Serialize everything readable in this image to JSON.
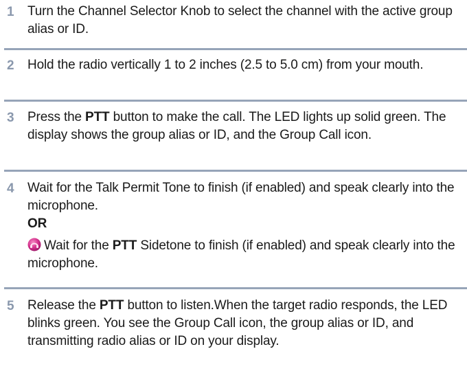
{
  "steps": [
    {
      "number": "1",
      "text": "Turn the Channel Selector Knob to select the channel with the active group alias or ID."
    },
    {
      "number": "2",
      "text": "Hold the radio vertically 1 to 2 inches (2.5 to 5.0 cm) from your mouth."
    },
    {
      "number": "3",
      "text_before": "Press the ",
      "bold": "PTT",
      "text_after": " button to make the call. The LED lights up solid green. The display shows the group alias or ID, and the Group Call icon."
    },
    {
      "number": "4",
      "text": "Wait for the Talk Permit Tone to finish (if enabled) and speak clearly into the microphone.",
      "or_label": "OR",
      "alt_icon": "sidetone-icon",
      "alt_before": "Wait for the ",
      "alt_bold": "PTT",
      "alt_after": " Sidetone to finish (if enabled) and speak clearly into the microphone."
    },
    {
      "number": "5",
      "text_before": "Release the ",
      "bold": "PTT",
      "text_after": " button to listen.When the target radio responds, the LED blinks green. You see the Group Call icon, the group alias or ID, and transmitting radio alias or ID on your display."
    }
  ],
  "colors": {
    "step_number": "#8a98ad",
    "divider": "#96a4b8",
    "icon_fill": "#d6338e"
  }
}
